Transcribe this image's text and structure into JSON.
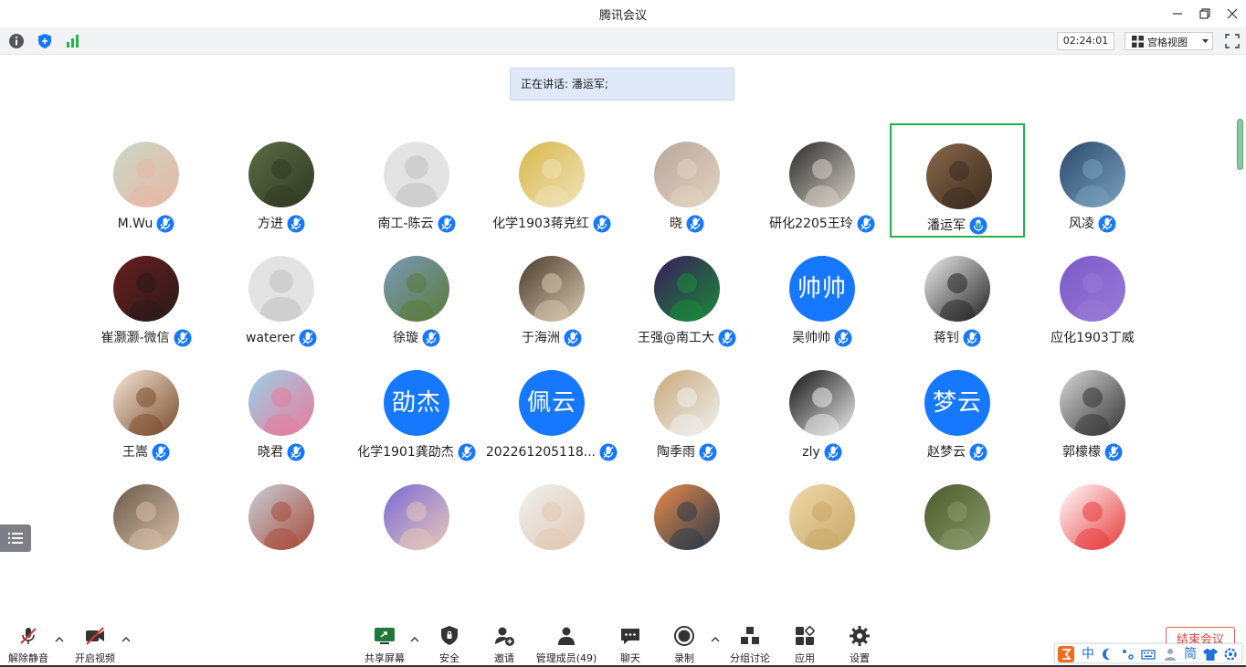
{
  "window": {
    "title": "腾讯会议"
  },
  "infobar": {
    "timer": "02:24:01",
    "view_label": "宫格视图"
  },
  "speaking": {
    "text": "正在讲话: 潘运军;"
  },
  "participants": [
    {
      "name": "M.Wu",
      "avatar": "photo",
      "mic": "muted"
    },
    {
      "name": "方进",
      "avatar": "photo",
      "mic": "muted"
    },
    {
      "name": "南工-陈云",
      "avatar": "default",
      "mic": "muted"
    },
    {
      "name": "化学1903蒋克红",
      "avatar": "photo",
      "mic": "muted"
    },
    {
      "name": "晓",
      "avatar": "photo",
      "mic": "muted"
    },
    {
      "name": "研化2205王玲",
      "avatar": "photo",
      "mic": "muted"
    },
    {
      "name": "潘运军",
      "avatar": "photo",
      "mic": "speaking",
      "active": true
    },
    {
      "name": "风凌",
      "avatar": "photo",
      "mic": "muted"
    },
    {
      "name": "崔灏灏-微信",
      "avatar": "photo",
      "mic": "muted"
    },
    {
      "name": "waterer",
      "avatar": "default",
      "mic": "muted"
    },
    {
      "name": "徐璇",
      "avatar": "photo",
      "mic": "muted"
    },
    {
      "name": "于海洲",
      "avatar": "photo",
      "mic": "muted"
    },
    {
      "name": "王强@南工大",
      "avatar": "photo",
      "mic": "muted"
    },
    {
      "name": "吴帅帅",
      "avatar": "text",
      "avatar_text": "帅帅",
      "mic": "muted"
    },
    {
      "name": "蒋钊",
      "avatar": "photo",
      "mic": "muted"
    },
    {
      "name": "应化1903丁威",
      "avatar": "photo",
      "mic": "none"
    },
    {
      "name": "王嵩",
      "avatar": "photo",
      "mic": "muted"
    },
    {
      "name": "晓君",
      "avatar": "photo",
      "mic": "muted"
    },
    {
      "name": "化学1901龚劭杰",
      "avatar": "text",
      "avatar_text": "劭杰",
      "mic": "muted"
    },
    {
      "name": "202261205118...",
      "avatar": "text",
      "avatar_text": "佩云",
      "mic": "muted"
    },
    {
      "name": "陶季雨",
      "avatar": "photo",
      "mic": "muted"
    },
    {
      "name": "zly",
      "avatar": "photo",
      "mic": "muted"
    },
    {
      "name": "赵梦云",
      "avatar": "text",
      "avatar_text": "梦云",
      "mic": "muted"
    },
    {
      "name": "郭檬檬",
      "avatar": "photo",
      "mic": "muted"
    },
    {
      "name": "",
      "avatar": "photo",
      "mic": "muted"
    },
    {
      "name": "",
      "avatar": "photo",
      "mic": "muted"
    },
    {
      "name": "",
      "avatar": "photo",
      "mic": "muted"
    },
    {
      "name": "",
      "avatar": "photo",
      "mic": "muted"
    },
    {
      "name": "",
      "avatar": "photo",
      "mic": "muted"
    },
    {
      "name": "",
      "avatar": "photo",
      "mic": "muted"
    },
    {
      "name": "",
      "avatar": "photo",
      "mic": "muted"
    },
    {
      "name": "",
      "avatar": "photo",
      "mic": "muted"
    }
  ],
  "toolbar": {
    "unmute": "解除静音",
    "start_video": "开启视频",
    "share_screen": "共享屏幕",
    "security": "安全",
    "invite": "邀请",
    "manage_members": "管理成员(49)",
    "chat": "聊天",
    "record": "录制",
    "breakout": "分组讨论",
    "apps": "应用",
    "settings": "设置",
    "end_meeting": "结束会议"
  },
  "ime": {
    "mode": "中",
    "script": "简"
  },
  "colors": {
    "accent": "#1677ff",
    "active_border": "#22b14c",
    "end_red": "#e04040"
  }
}
